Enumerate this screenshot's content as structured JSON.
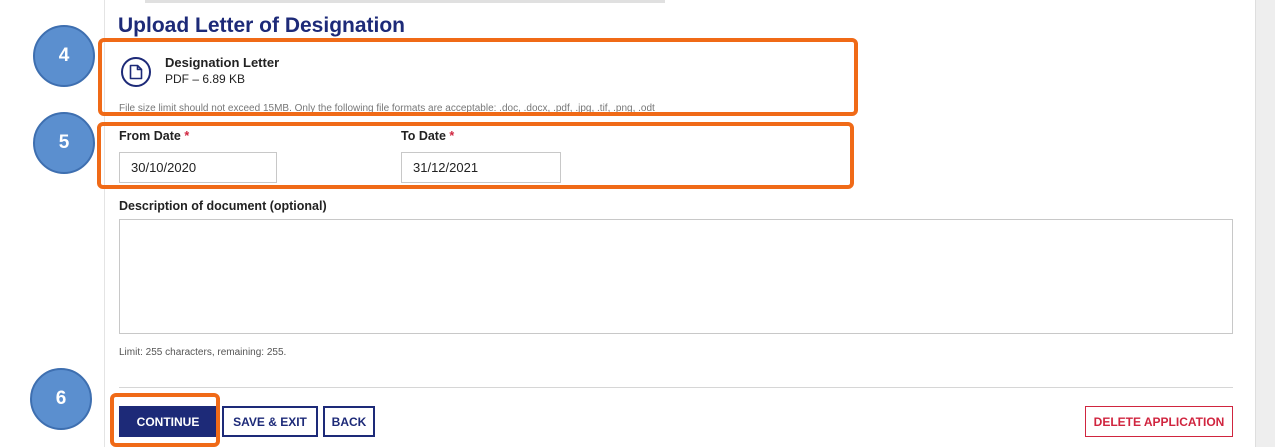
{
  "section": {
    "title": "Upload Letter of Designation"
  },
  "file": {
    "name": "Designation Letter",
    "meta": "PDF – 6.89 KB",
    "icon": "document-icon"
  },
  "file_note": "File size limit should not exceed 15MB. Only the following file formats are acceptable: .doc, .docx, .pdf, .jpg, .tif, .png, .odt",
  "from_date": {
    "label": "From Date",
    "required": "*",
    "value": "30/10/2020"
  },
  "to_date": {
    "label": "To Date",
    "required": "*",
    "value": "31/12/2021"
  },
  "description": {
    "label": "Description of document (optional)",
    "value": "",
    "limit_text": "Limit: 255 characters, remaining: 255."
  },
  "actions": {
    "continue": "CONTINUE",
    "save_exit": "SAVE & EXIT",
    "back": "BACK",
    "delete": "DELETE APPLICATION"
  },
  "annotations": {
    "step4": "4",
    "step5": "5",
    "step6": "6"
  },
  "colors": {
    "brand_navy": "#1d2a78",
    "danger": "#d0253f",
    "callout_orange": "#f06a17",
    "badge_blue": "#5b8fcf"
  }
}
